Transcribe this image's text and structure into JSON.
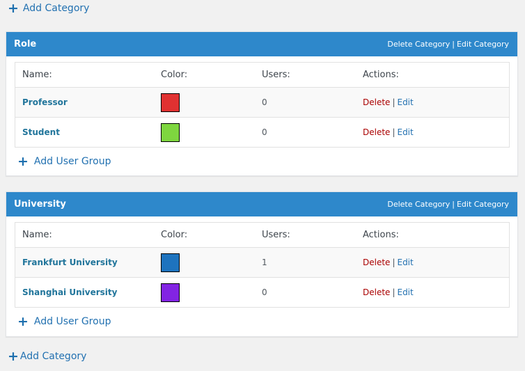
{
  "add_category_label": "Add Category",
  "category_actions": {
    "delete_label": "Delete Category",
    "separator": "|",
    "edit_label": "Edit Category"
  },
  "table_headers": {
    "name": "Name:",
    "color": "Color:",
    "users": "Users:",
    "actions": "Actions:"
  },
  "row_actions": {
    "delete_label": "Delete",
    "separator": "|",
    "edit_label": "Edit"
  },
  "add_user_group_label": "Add User Group",
  "icons": {
    "add": "plus-icon"
  },
  "colors": {
    "header_bg": "#2e88cb",
    "link": "#2271b1",
    "delete": "#aa0000"
  },
  "categories": [
    {
      "title": "Role",
      "groups": [
        {
          "name": "Professor",
          "color": "#e03131",
          "users": "0"
        },
        {
          "name": "Student",
          "color": "#7ed63f",
          "users": "0"
        }
      ]
    },
    {
      "title": "University",
      "groups": [
        {
          "name": "Frankfurt University",
          "color": "#1e73be",
          "users": "1"
        },
        {
          "name": "Shanghai University",
          "color": "#8224e3",
          "users": "0"
        }
      ]
    }
  ]
}
